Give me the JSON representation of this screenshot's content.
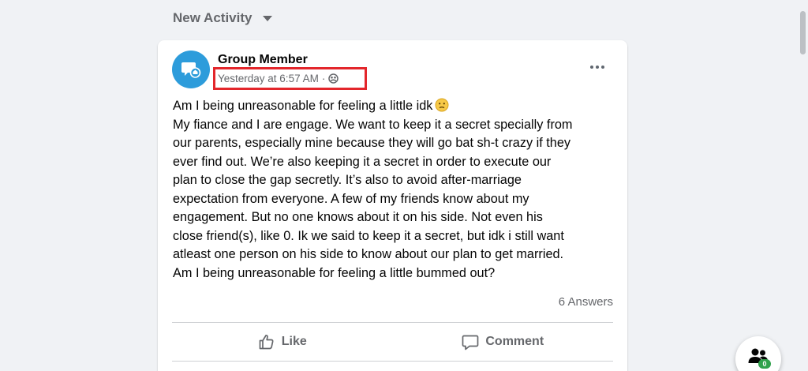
{
  "filter": {
    "label": "New Activity"
  },
  "post": {
    "author": "Group Member",
    "timestamp": "Yesterday at 6:57 AM",
    "separator": "·",
    "privacy_icon": "group-privacy-icon",
    "body_lines": [
      "Am I being unreasonable for feeling a little idk",
      "My fiance and I are engage. We want to keep it a secret specially from",
      "our parents, especially mine because they will go bat sh-t crazy if they",
      "ever find out. We’re also keeping it a secret in order to execute our",
      "plan to close the gap secretly. It’s also to avoid after-marriage",
      "expectation from everyone. A few of my friends know about my",
      "engagement. But no one knows about it on his side. Not even his",
      "close friend(s), like 0. Ik we said to keep it a secret, but idk i still want",
      "atleast one person on his side to know about our plan to get married.",
      "Am I being unreasonable for feeling a little bummed out?"
    ],
    "answers_count": "6 Answers",
    "actions": {
      "like": "Like",
      "comment": "Comment"
    }
  },
  "chat": {
    "badge": "0"
  },
  "colors": {
    "accent": "#2d9cdb",
    "highlight": "#e3262b",
    "muted": "#65676b",
    "background": "#f0f2f5",
    "online": "#31a24c"
  }
}
